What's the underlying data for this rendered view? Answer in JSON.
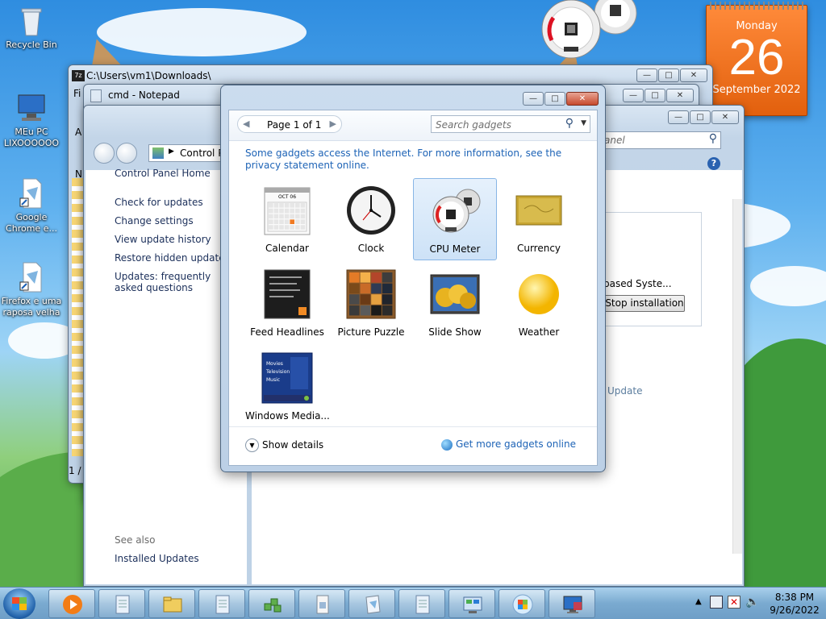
{
  "desktop": {
    "icons": [
      {
        "label": "Recycle Bin"
      },
      {
        "label": "MEu PC LIXOOOOOO"
      },
      {
        "label": "Google Chrome e..."
      },
      {
        "label": "Firefox e uma raposa velha"
      }
    ]
  },
  "windows": {
    "seven_zip": {
      "title": "C:\\Users\\vm1\\Downloads\\",
      "side_letters": [
        "Fi",
        "A",
        "N"
      ],
      "status": "1 /"
    },
    "notepad": {
      "title": "cmd - Notepad"
    },
    "control_panel": {
      "address": "Control P",
      "search_placeholder": "anel",
      "sidebar": {
        "home": "Control Panel Home",
        "links": [
          "Check for updates",
          "Change settings",
          "View update history",
          "Restore hidden updates",
          "Updates: frequently asked questions"
        ],
        "see_also": "See also",
        "installed_updates": "Installed Updates"
      },
      "main": {
        "item_text": "based Syste...",
        "stop_button": "Stop installation",
        "update_link": "Update"
      }
    }
  },
  "gallery": {
    "pager": "Page 1 of 1",
    "search_placeholder": "Search gadgets",
    "info": "Some gadgets access the Internet.  For more information, see the privacy statement online.",
    "gadgets": [
      {
        "label": "Calendar",
        "icon": "calendar-icon"
      },
      {
        "label": "Clock",
        "icon": "clock-icon"
      },
      {
        "label": "CPU Meter",
        "icon": "cpu-meter-icon",
        "selected": true
      },
      {
        "label": "Currency",
        "icon": "currency-icon"
      },
      {
        "label": "Feed Headlines",
        "icon": "feed-icon"
      },
      {
        "label": "Picture Puzzle",
        "icon": "puzzle-icon"
      },
      {
        "label": "Slide Show",
        "icon": "slideshow-icon"
      },
      {
        "label": "Weather",
        "icon": "weather-icon"
      },
      {
        "label": "Windows Media...",
        "icon": "media-center-icon",
        "sub": [
          "Movies",
          "Television",
          "Music"
        ]
      }
    ],
    "calendar_month": "OCT 06",
    "show_details": "Show details",
    "get_more": "Get more gadgets online"
  },
  "calendar_gadget": {
    "weekday": "Monday",
    "day": "26",
    "month_year": "September 2022"
  },
  "taskbar": {
    "time": "8:38 PM",
    "date": "9/26/2022"
  },
  "colors": {
    "accent": "#1d63b6",
    "calendar_orange": "#f07a22",
    "taskbar": "#7aaad0"
  }
}
